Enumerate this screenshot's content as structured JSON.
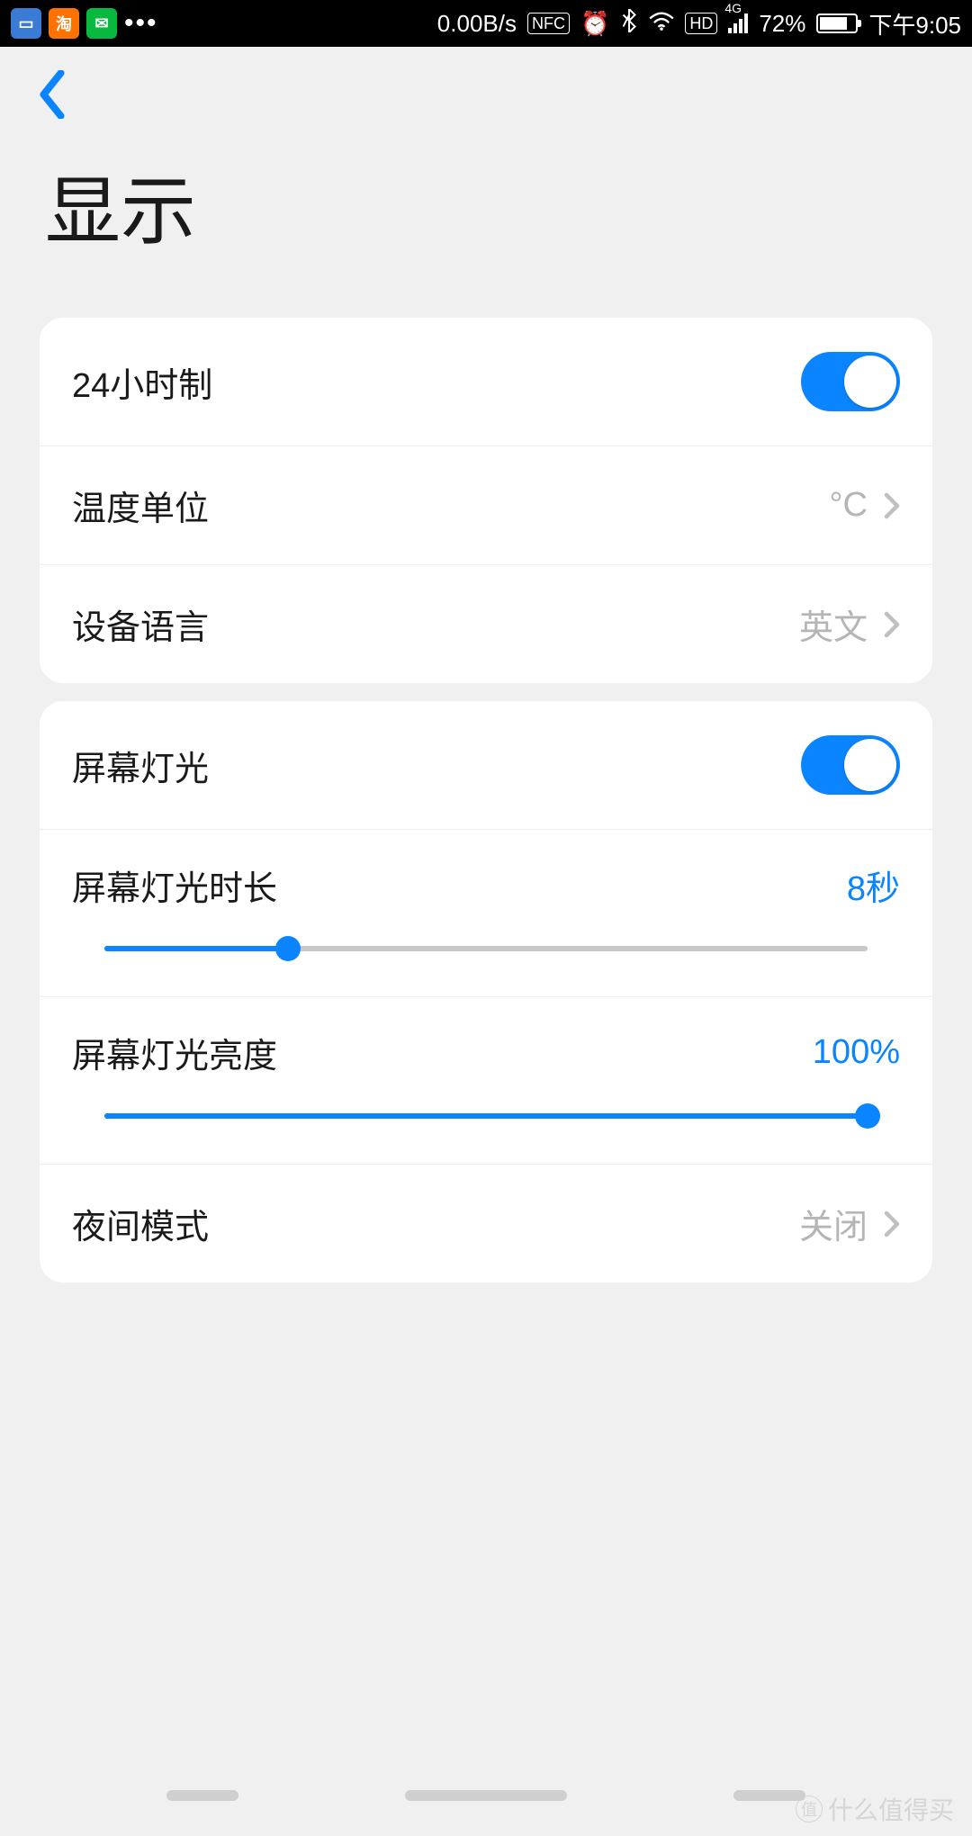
{
  "statusbar": {
    "speed": "0.00B/s",
    "nfc": "NFC",
    "hd": "HD",
    "net": "4G",
    "battery_pct": "72%",
    "time": "下午9:05"
  },
  "page": {
    "title": "显示"
  },
  "group1": {
    "time24": {
      "label": "24小时制",
      "on": true
    },
    "temp_unit": {
      "label": "温度单位",
      "value": "°C"
    },
    "device_lang": {
      "label": "设备语言",
      "value": "英文"
    }
  },
  "group2": {
    "screen_light": {
      "label": "屏幕灯光",
      "on": true
    },
    "light_duration": {
      "label": "屏幕灯光时长",
      "value_text": "8秒",
      "percent": 24
    },
    "light_brightness": {
      "label": "屏幕灯光亮度",
      "value_text": "100%",
      "percent": 100
    },
    "night_mode": {
      "label": "夜间模式",
      "value": "关闭"
    }
  },
  "watermark": "什么值得买"
}
